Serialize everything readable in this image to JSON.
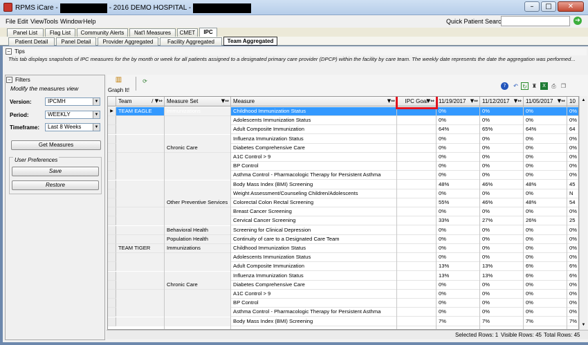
{
  "window": {
    "title_prefix": "RPMS iCare -",
    "title_mid": "- 2016 DEMO HOSPITAL -",
    "controls": {
      "minimize": "–",
      "maximize": "□",
      "close": "✕"
    }
  },
  "menu": [
    "File",
    "Edit",
    "View",
    "Tools",
    "Window",
    "Help"
  ],
  "quick_search": {
    "label": "Quick Patient Search:",
    "value": "",
    "go": "➔"
  },
  "main_tabs": [
    "Panel List",
    "Flag List",
    "Community Alerts",
    "Nat'l Measures",
    "CMET",
    "IPC"
  ],
  "sub_tabs": [
    "Patient Detail",
    "Panel Detail",
    "Provider Aggregated",
    "Facility Aggregated",
    "Team Aggregated"
  ],
  "tips": {
    "heading": "Tips",
    "toggle": "−",
    "text": "This tab displays snapshots of IPC measures for the by month or week for all patients assigned to a designated primary care provider (DPCP) within the facility by care team.  The weekly date represents the date the aggregation was performed..."
  },
  "filters": {
    "heading": "Filters",
    "toggle": "−",
    "subtitle": "Modify the measures view",
    "version_label": "Version:",
    "version_value": "IPCMH",
    "period_label": "Period:",
    "period_value": "WEEKLY",
    "timeframe_label": "Timeframe:",
    "timeframe_value": "Last 8 Weeks",
    "get_measures": "Get Measures",
    "user_prefs": "User Preferences",
    "save": "Save",
    "restore": "Restore"
  },
  "toolbar": {
    "graph_label": "Graph It!"
  },
  "columns": [
    "Team",
    "Measure Set",
    "Measure",
    "IPC Goal",
    "11/19/2017",
    "11/12/2017",
    "11/05/2017",
    "10"
  ],
  "rows": [
    {
      "team": "TEAM EAGLE",
      "set": "Immunizations",
      "measure": "Childhood Immunization Status",
      "v": [
        "0%",
        "0%",
        "0%",
        "0%"
      ],
      "selected": true
    },
    {
      "team": "",
      "set": "",
      "measure": "Adolescents Immunization Status",
      "v": [
        "0%",
        "0%",
        "0%",
        "0%"
      ]
    },
    {
      "team": "",
      "set": "",
      "measure": "Adult Composite Immunization",
      "v": [
        "64%",
        "65%",
        "64%",
        "64"
      ]
    },
    {
      "team": "",
      "set": "",
      "measure": "Influenza Immunization Status",
      "v": [
        "0%",
        "0%",
        "0%",
        "0%"
      ]
    },
    {
      "team": "",
      "set": "Chronic Care",
      "measure": "Diabetes Comprehensive Care",
      "v": [
        "0%",
        "0%",
        "0%",
        "0%"
      ]
    },
    {
      "team": "",
      "set": "",
      "measure": "A1C Control > 9",
      "v": [
        "0%",
        "0%",
        "0%",
        "0%"
      ]
    },
    {
      "team": "",
      "set": "",
      "measure": "BP Control",
      "v": [
        "0%",
        "0%",
        "0%",
        "0%"
      ]
    },
    {
      "team": "",
      "set": "",
      "measure": "Asthma Control - Pharmacologic Therapy for Persistent Asthma",
      "v": [
        "0%",
        "0%",
        "0%",
        "0%"
      ]
    },
    {
      "team": "",
      "set": "",
      "measure": "Body Mass Index (BMI) Screening",
      "v": [
        "48%",
        "46%",
        "48%",
        "45"
      ]
    },
    {
      "team": "",
      "set": "",
      "measure": "Weight Assessment/Counseling Children/Adolescents",
      "v": [
        "0%",
        "0%",
        "0%",
        "N"
      ]
    },
    {
      "team": "",
      "set": "Other Preventive Services",
      "measure": "Colorectal Colon Rectal Screening",
      "v": [
        "55%",
        "46%",
        "48%",
        "54"
      ]
    },
    {
      "team": "",
      "set": "",
      "measure": "Breast Cancer Screening",
      "v": [
        "0%",
        "0%",
        "0%",
        "0%"
      ]
    },
    {
      "team": "",
      "set": "",
      "measure": "Cervical Cancer Screening",
      "v": [
        "33%",
        "27%",
        "26%",
        "25"
      ]
    },
    {
      "team": "",
      "set": "Behavioral Health",
      "measure": "Screening for Clinical Depression",
      "v": [
        "0%",
        "0%",
        "0%",
        "0%"
      ]
    },
    {
      "team": "",
      "set": "Population Health",
      "measure": "Continuity of care to a Designated Care Team",
      "v": [
        "0%",
        "0%",
        "0%",
        "0%"
      ]
    },
    {
      "team": "TEAM TIGER",
      "set": "Immunizations",
      "measure": "Childhood Immunization Status",
      "v": [
        "0%",
        "0%",
        "0%",
        "0%"
      ]
    },
    {
      "team": "",
      "set": "",
      "measure": "Adolescents Immunization Status",
      "v": [
        "0%",
        "0%",
        "0%",
        "0%"
      ]
    },
    {
      "team": "",
      "set": "",
      "measure": "Adult Composite Immunization",
      "v": [
        "13%",
        "13%",
        "6%",
        "6%"
      ]
    },
    {
      "team": "",
      "set": "",
      "measure": "Influenza Immunization Status",
      "v": [
        "13%",
        "13%",
        "6%",
        "6%"
      ]
    },
    {
      "team": "",
      "set": "Chronic Care",
      "measure": "Diabetes Comprehensive Care",
      "v": [
        "0%",
        "0%",
        "0%",
        "0%"
      ]
    },
    {
      "team": "",
      "set": "",
      "measure": "A1C Control > 9",
      "v": [
        "0%",
        "0%",
        "0%",
        "0%"
      ]
    },
    {
      "team": "",
      "set": "",
      "measure": "BP Control",
      "v": [
        "0%",
        "0%",
        "0%",
        "0%"
      ]
    },
    {
      "team": "",
      "set": "",
      "measure": "Asthma Control - Pharmacologic Therapy for Persistent Asthma",
      "v": [
        "0%",
        "0%",
        "0%",
        "0%"
      ]
    },
    {
      "team": "",
      "set": "",
      "measure": "Body Mass Index (BMI) Screening",
      "v": [
        "7%",
        "7%",
        "7%",
        "7%"
      ]
    }
  ],
  "status": {
    "selected": "Selected Rows: 1",
    "visible": "Visible Rows: 45",
    "total": "Total Rows: 45"
  },
  "colors": {
    "selection": "#3399ff",
    "highlight_box": "#e0131f",
    "window_bg": "#6d88ad"
  }
}
